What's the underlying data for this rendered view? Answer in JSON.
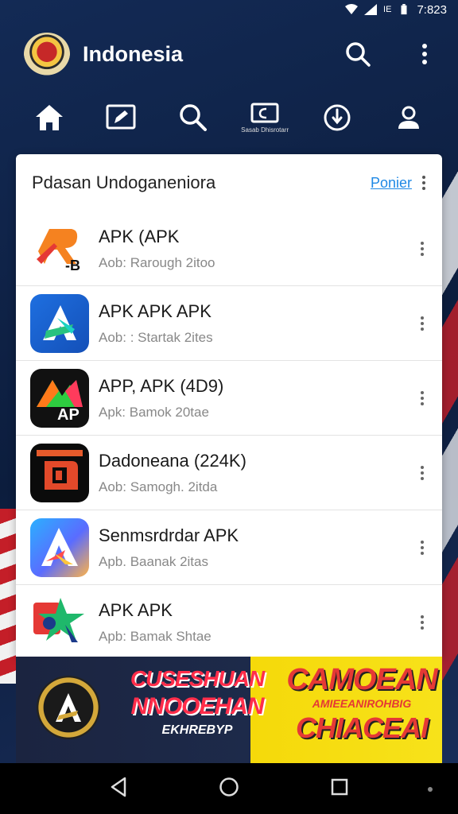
{
  "status_bar": {
    "time": "7:823",
    "badge": "IE"
  },
  "header": {
    "title": "Indonesia"
  },
  "nav": {
    "items": [
      {
        "name": "home"
      },
      {
        "name": "edit"
      },
      {
        "name": "search"
      },
      {
        "name": "tv",
        "label": "Sasab Dhisrotarr"
      },
      {
        "name": "download"
      },
      {
        "name": "profile"
      }
    ]
  },
  "card": {
    "title": "Pdasan Undoganeniora",
    "action": "Ponier",
    "items": [
      {
        "name": "APK (APK",
        "sub": "Aob: Rarough 2itoo"
      },
      {
        "name": "APK APK APK",
        "sub": "Aob: : Startak 2ites"
      },
      {
        "name": "APP, APK (4D9)",
        "sub": "Apk: Bamok 20tae"
      },
      {
        "name": "Dadoneana (224K)",
        "sub": "Aob: Samogh. 2itda"
      },
      {
        "name": "Senmsrdrdar APK",
        "sub": "Apb. Baanak 2itas"
      },
      {
        "name": "APK  APK",
        "sub": "Apb: Bamak Shtae"
      }
    ]
  },
  "ad": {
    "left_line1": "CUSESHUAN",
    "left_line2": "NNOOEHAN",
    "left_line3": "EKHREBYP",
    "right_line1": "CAMOEAN",
    "right_line2": "AMIEEANIROHBIG",
    "right_line3": "CHIACEAI"
  }
}
